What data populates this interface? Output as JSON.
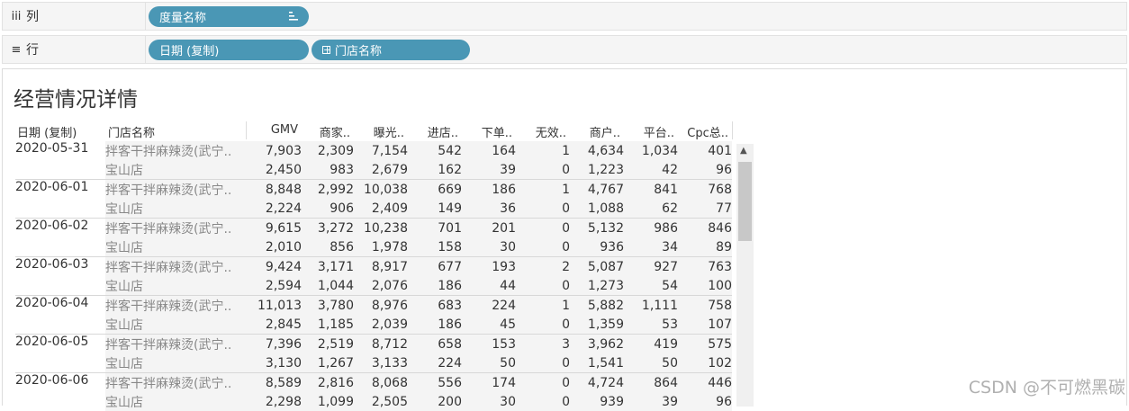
{
  "shelves": {
    "columns": {
      "icon": "iii",
      "label": "列",
      "pills": [
        {
          "label": "度量名称",
          "icon": "sort-icon"
        }
      ]
    },
    "rows": {
      "icon": "≡",
      "label": "行",
      "pills": [
        {
          "label": "日期 (复制)"
        },
        {
          "label": "门店名称",
          "icon": "plus-icon"
        }
      ]
    }
  },
  "view": {
    "title": "经营情况详情",
    "headers": {
      "date": "日期 (复制)",
      "store": "门店名称",
      "measures": [
        "GMV",
        "商家..",
        "曝光..",
        "进店..",
        "下单..",
        "无效..",
        "商户..",
        "平台..",
        "Cpc总.."
      ]
    },
    "rows": [
      {
        "date": "2020-05-31",
        "store": "拌客干拌麻辣烫(武宁..",
        "values": [
          "7,903",
          "2,309",
          "7,154",
          "542",
          "164",
          "1",
          "4,634",
          "1,034",
          "401"
        ]
      },
      {
        "date": "",
        "store": "宝山店",
        "values": [
          "2,450",
          "983",
          "2,679",
          "162",
          "39",
          "0",
          "1,223",
          "42",
          "96"
        ]
      },
      {
        "date": "2020-06-01",
        "store": "拌客干拌麻辣烫(武宁..",
        "values": [
          "8,848",
          "2,992",
          "10,038",
          "669",
          "186",
          "1",
          "4,767",
          "841",
          "768"
        ]
      },
      {
        "date": "",
        "store": "宝山店",
        "values": [
          "2,224",
          "906",
          "2,409",
          "149",
          "36",
          "0",
          "1,088",
          "62",
          "77"
        ]
      },
      {
        "date": "2020-06-02",
        "store": "拌客干拌麻辣烫(武宁..",
        "values": [
          "9,615",
          "3,272",
          "10,238",
          "701",
          "201",
          "0",
          "5,132",
          "986",
          "846"
        ]
      },
      {
        "date": "",
        "store": "宝山店",
        "values": [
          "2,010",
          "856",
          "1,978",
          "158",
          "30",
          "0",
          "936",
          "34",
          "89"
        ]
      },
      {
        "date": "2020-06-03",
        "store": "拌客干拌麻辣烫(武宁..",
        "values": [
          "9,424",
          "3,171",
          "8,917",
          "677",
          "193",
          "2",
          "5,087",
          "927",
          "763"
        ]
      },
      {
        "date": "",
        "store": "宝山店",
        "values": [
          "2,594",
          "1,044",
          "2,076",
          "186",
          "44",
          "0",
          "1,273",
          "54",
          "100"
        ]
      },
      {
        "date": "2020-06-04",
        "store": "拌客干拌麻辣烫(武宁..",
        "values": [
          "11,013",
          "3,780",
          "8,976",
          "683",
          "224",
          "1",
          "5,882",
          "1,111",
          "758"
        ]
      },
      {
        "date": "",
        "store": "宝山店",
        "values": [
          "2,845",
          "1,185",
          "2,039",
          "186",
          "45",
          "0",
          "1,359",
          "53",
          "107"
        ]
      },
      {
        "date": "2020-06-05",
        "store": "拌客干拌麻辣烫(武宁..",
        "values": [
          "7,396",
          "2,519",
          "8,712",
          "658",
          "153",
          "3",
          "3,962",
          "419",
          "575"
        ]
      },
      {
        "date": "",
        "store": "宝山店",
        "values": [
          "3,130",
          "1,267",
          "3,133",
          "224",
          "50",
          "0",
          "1,541",
          "50",
          "102"
        ]
      },
      {
        "date": "2020-06-06",
        "store": "拌客干拌麻辣烫(武宁..",
        "values": [
          "8,589",
          "2,816",
          "8,068",
          "556",
          "174",
          "0",
          "4,724",
          "864",
          "446"
        ]
      },
      {
        "date": "",
        "store": "宝山店",
        "values": [
          "2,298",
          "1,099",
          "2,505",
          "200",
          "30",
          "0",
          "939",
          "39",
          "96"
        ]
      }
    ]
  },
  "watermark": "CSDN @不可燃黑碳",
  "colors": {
    "pill": "#4a97b5",
    "shelf_bg": "#f5f5f5",
    "cell_bg": "#f4f4f4"
  }
}
